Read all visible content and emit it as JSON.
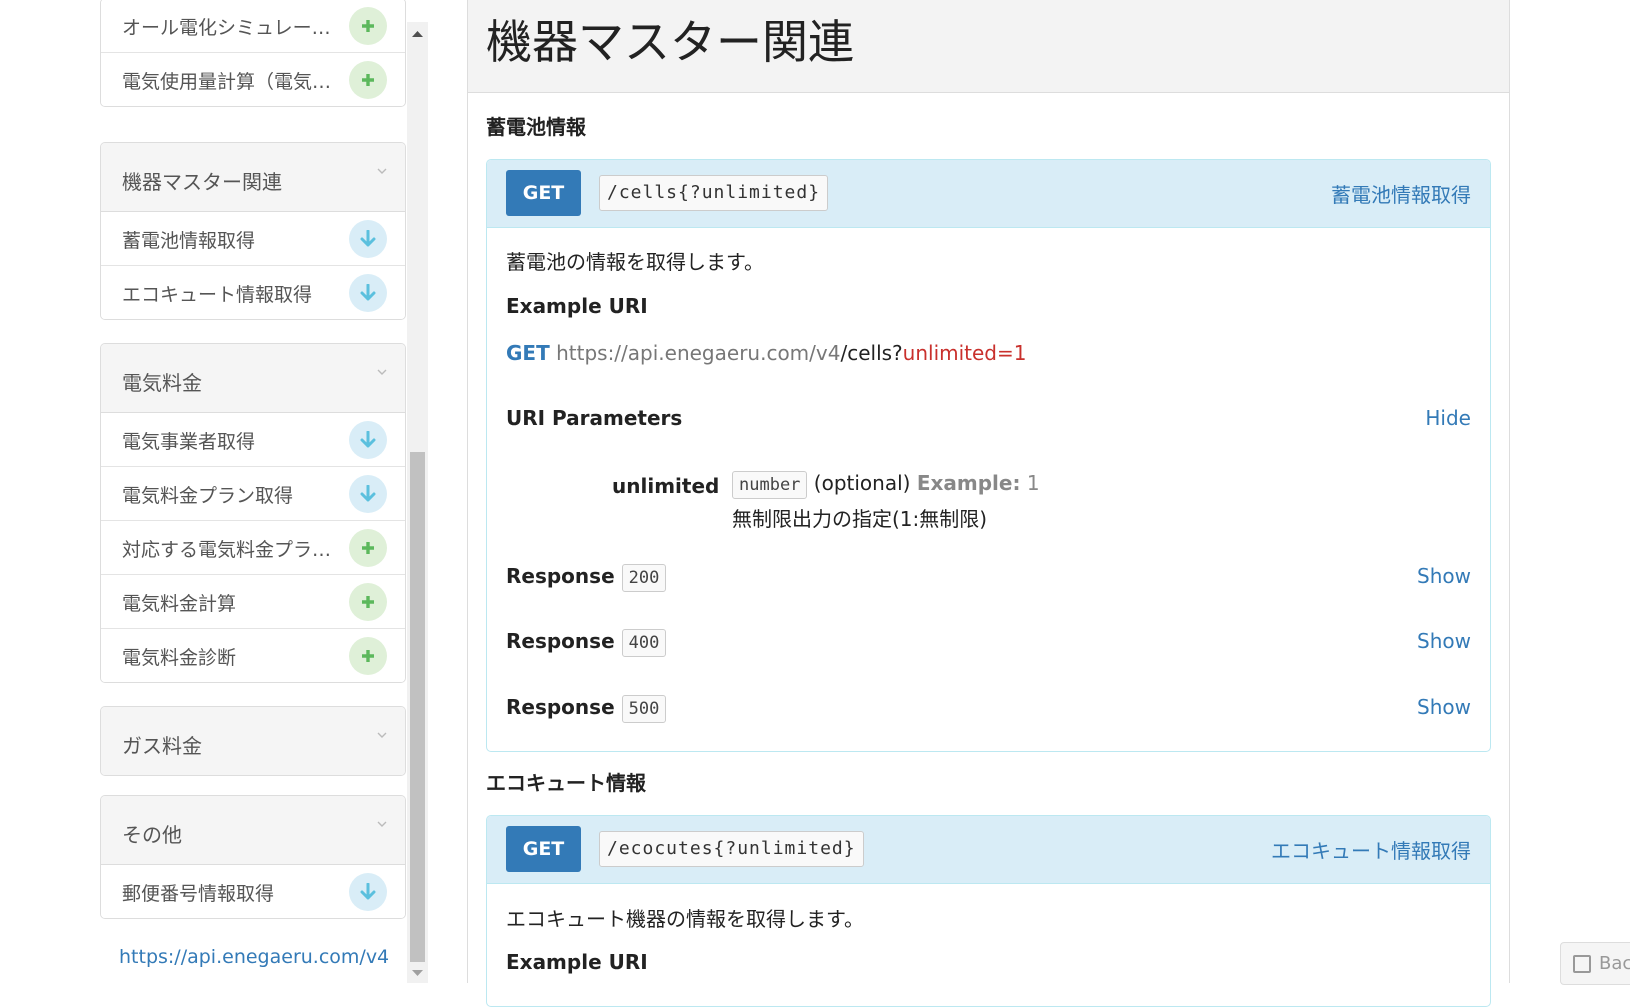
{
  "sidebar": {
    "group_top": {
      "items": [
        {
          "label": "オール電化シミュレー…",
          "icon": "plus-icon"
        },
        {
          "label": "電気使用量計算（電気…",
          "icon": "plus-icon"
        }
      ]
    },
    "group_equipment": {
      "title": "機器マスター関連",
      "items": [
        {
          "label": "蓄電池情報取得",
          "icon": "arrow-down-icon"
        },
        {
          "label": "エコキュート情報取得",
          "icon": "arrow-down-icon"
        }
      ]
    },
    "group_electricity": {
      "title": "電気料金",
      "items": [
        {
          "label": "電気事業者取得",
          "icon": "arrow-down-icon"
        },
        {
          "label": "電気料金プラン取得",
          "icon": "arrow-down-icon"
        },
        {
          "label": "対応する電気料金プラ…",
          "icon": "plus-icon"
        },
        {
          "label": "電気料金計算",
          "icon": "plus-icon"
        },
        {
          "label": "電気料金診断",
          "icon": "plus-icon"
        }
      ]
    },
    "group_gas": {
      "title": "ガス料金"
    },
    "group_other": {
      "title": "その他",
      "items": [
        {
          "label": "郵便番号情報取得",
          "icon": "arrow-down-icon"
        }
      ]
    },
    "base_url_link": "https://api.enegaeru.com/v4"
  },
  "main": {
    "page_title": "機器マスター関連",
    "sections": [
      {
        "title": "蓄電池情報",
        "method": "GET",
        "path": "/cells{?unlimited}",
        "action_link": "蓄電池情報取得",
        "description": "蓄電池の情報を取得します。",
        "example_label": "Example URI",
        "example_uri": {
          "method": "GET",
          "host": "https://api.enegaeru.com/v4",
          "path": "/cells?",
          "query": "unlimited=1"
        },
        "params_label": "URI Parameters",
        "params_toggle": "Hide",
        "param": {
          "name": "unlimited",
          "type": "number",
          "optional": "(optional)",
          "example_label": "Example:",
          "example_value": "1",
          "description": "無制限出力の指定(1:無制限)"
        },
        "responses": [
          {
            "label": "Response",
            "code": "200",
            "toggle": "Show"
          },
          {
            "label": "Response",
            "code": "400",
            "toggle": "Show"
          },
          {
            "label": "Response",
            "code": "500",
            "toggle": "Show"
          }
        ]
      },
      {
        "title": "エコキュート情報",
        "method": "GET",
        "path": "/ecocutes{?unlimited}",
        "action_link": "エコキュート情報取得",
        "description": "エコキュート機器の情報を取得します。",
        "example_label": "Example URI"
      }
    ]
  },
  "back_button": {
    "label": "Bac"
  },
  "colors": {
    "accent": "#337ab7",
    "plus_badge_bg": "#dff0d8",
    "plus_icon": "#5cb85c",
    "down_badge_bg": "#d9edf7",
    "down_icon": "#5bc0de",
    "query_red": "#c9302c"
  }
}
